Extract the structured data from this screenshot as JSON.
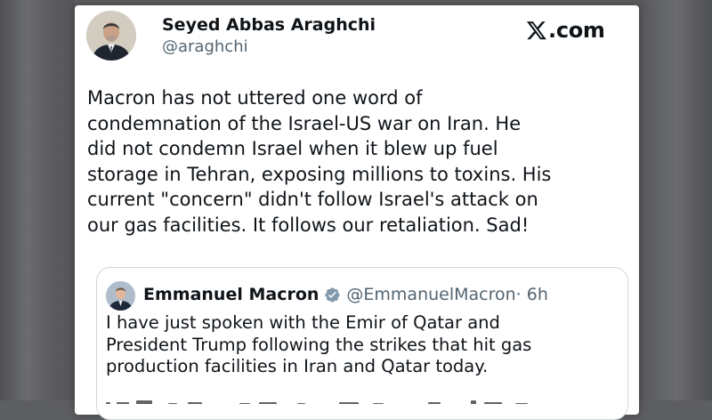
{
  "author": {
    "name": "Seyed Abbas Araghchi",
    "handle": "@araghchi"
  },
  "site": {
    "icon": "x-logo-icon",
    "label": ".com"
  },
  "tweet": {
    "lines": [
      "Macron has not uttered one word of",
      "condemnation of the Israel-US war on Iran. He",
      "did not condemn Israel when it blew up fuel",
      "storage in Tehran, exposing millions to toxins. His",
      "current \"concern\" didn't follow Israel's attack on",
      "our gas facilities. It follows our retaliation. Sad!"
    ]
  },
  "quote": {
    "name": "Emmanuel Macron",
    "verified_icon": "verified-badge-icon",
    "verified_color": "#829aab",
    "handle": "@EmmanuelMacron",
    "time": " · 6h",
    "lines": [
      "I have just spoken with the Emir of Qatar and",
      "President Trump following the strikes that hit gas",
      "production facilities in Iran and Qatar today."
    ]
  },
  "colors": {
    "text": "#0f1419",
    "secondary": "#536471",
    "border": "#cfd9de"
  }
}
